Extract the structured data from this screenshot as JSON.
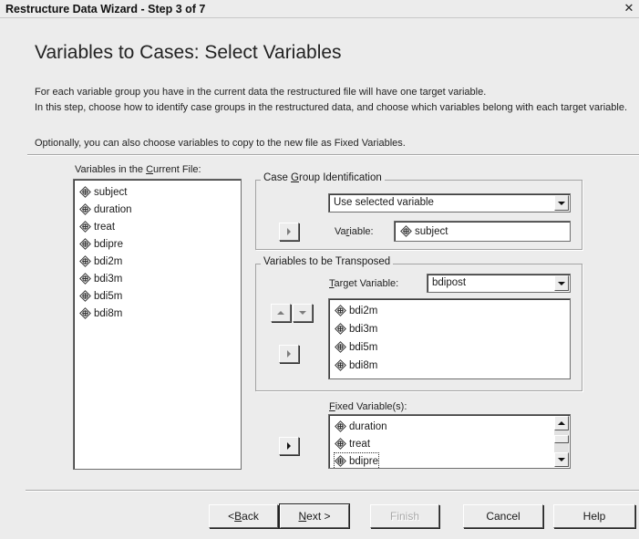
{
  "window": {
    "title": "Restructure Data Wizard - Step 3 of 7",
    "close_glyph": "✕"
  },
  "page": {
    "heading": "Variables to Cases: Select Variables",
    "intro_1": "For each variable group you have in the current data the restructured file will have one target variable.",
    "intro_2": "In this step, choose how to identify case groups in the restructured data, and choose which variables belong with each target variable.",
    "intro_3": "Optionally, you can also choose variables to copy to the new file as Fixed Variables."
  },
  "current_vars": {
    "label_pre": "Variables in the ",
    "label_key": "C",
    "label_post": "urrent File:",
    "items": [
      "subject",
      "duration",
      "treat",
      "bdipre",
      "bdi2m",
      "bdi3m",
      "bdi5m",
      "bdi8m"
    ]
  },
  "case_group": {
    "title_pre": "Case ",
    "title_key": "G",
    "title_post": "roup Identification",
    "method_value": "Use selected variable",
    "variable_label_pre": "Va",
    "variable_label_key": "r",
    "variable_label_post": "iable:",
    "variable_value": "subject"
  },
  "transposed": {
    "title": "Variables to be Transposed",
    "target_label_key": "T",
    "target_label_post": "arget Variable:",
    "target_value": "bdipost",
    "items": [
      "bdi2m",
      "bdi3m",
      "bdi5m",
      "bdi8m"
    ]
  },
  "fixed": {
    "label_key": "F",
    "label_post": "ixed Variable(s):",
    "items": [
      "duration",
      "treat",
      "bdipre"
    ]
  },
  "buttons": {
    "back_pre": "< ",
    "back_key": "B",
    "back_post": "ack",
    "next_key": "N",
    "next_post": "ext >",
    "finish": "Finish",
    "cancel": "Cancel",
    "help": "Help"
  },
  "icons": {
    "variable": "scale-variable-icon",
    "move_right": "arrow-right-icon",
    "move_up": "arrow-up-icon",
    "move_down": "arrow-down-icon",
    "dropdown": "chevron-down-icon"
  }
}
